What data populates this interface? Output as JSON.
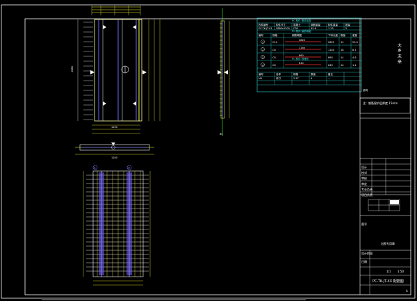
{
  "drawing": {
    "side_note_vertical": "大 乡 未 来",
    "title_block": {
      "project_label": "PC-TK-JT-XX 配筋图",
      "sheet_no": "1/1",
      "scale": "1:50",
      "revision": "A",
      "row_labels": [
        "设计",
        "校对",
        "审核",
        "审定",
        "专业负责",
        "项目负责"
      ],
      "stamp_label": "出图专用章",
      "drawing_no_label": "图号",
      "mini_labels": [
        "设计阶段",
        "日期"
      ]
    },
    "table": {
      "title_1": "PC 构件 基本信息",
      "headers_1": [
        "构件编号",
        "构件尺寸",
        "混凝土",
        "钢筋重量",
        "构件重量",
        "数量"
      ],
      "row_1": [
        "PC-TK-JT-01",
        "2880x1200",
        "C30",
        "45.6",
        "1.25",
        "2"
      ],
      "title_2": "PC 构件 钢筋明细",
      "headers_2": [
        "编号",
        "规格",
        "钢筋简图",
        "下料长度",
        "数量",
        "重量"
      ],
      "rows_2": [
        [
          "1",
          "C10",
          "2820",
          "2820",
          "12",
          "20.9"
        ],
        [
          "2",
          "C8",
          "1140",
          "1140",
          "18",
          "8.1"
        ],
        [
          "3",
          "C8",
          "860",
          "860",
          "14",
          "4.8"
        ],
        [
          "4",
          "C6",
          "640",
          "640",
          "10",
          "1.4"
        ]
      ],
      "title_3": "PC 构件 预埋件",
      "headers_3": [
        "编号",
        "名称",
        "规格",
        "数量",
        "备注"
      ],
      "row_3": [
        "M1",
        "吊钉",
        "2.5T",
        "4",
        "—"
      ],
      "note": "注：钢筋保护层厚度 15mm",
      "note_right": "说明"
    },
    "dimensions": {
      "overall_height": "2880",
      "overall_width": "1200",
      "side_depth": "60",
      "bottom_width": "1200"
    },
    "markers": {
      "grid_1": "1",
      "grid_2": "2",
      "north": "N"
    }
  }
}
